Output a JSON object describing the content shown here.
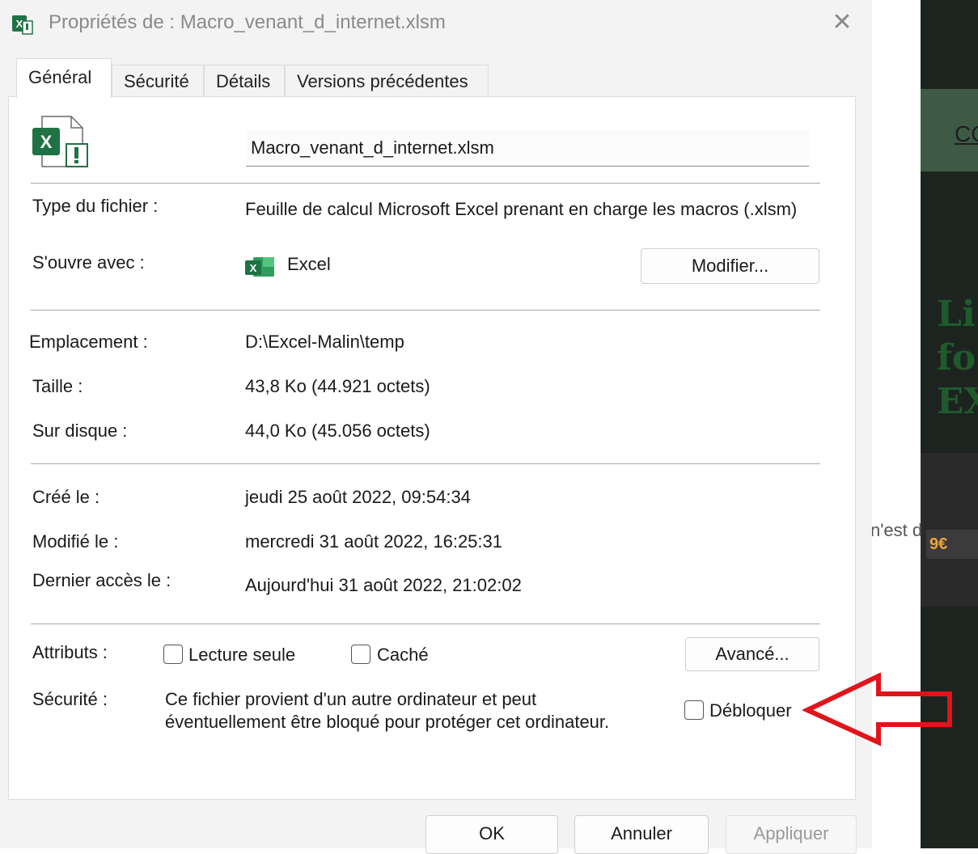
{
  "window": {
    "title": "Propriétés de : Macro_venant_d_internet.xlsm",
    "close_glyph": "✕"
  },
  "tabs": [
    {
      "label": "Général",
      "active": true
    },
    {
      "label": "Sécurité",
      "active": false
    },
    {
      "label": "Détails",
      "active": false
    },
    {
      "label": "Versions précédentes",
      "active": false
    }
  ],
  "file": {
    "name": "Macro_venant_d_internet.xlsm",
    "type_label": "Type du fichier :",
    "type_value": "Feuille de calcul Microsoft Excel prenant en charge les macros (.xlsm)",
    "opens_with_label": "S'ouvre avec :",
    "opens_with_value": "Excel",
    "change_button": "Modifier...",
    "location_label": "Emplacement :",
    "location_value": "D:\\Excel-Malin\\temp",
    "size_label": "Taille :",
    "size_value": "43,8 Ko (44.921 octets)",
    "disk_label": "Sur disque :",
    "disk_value": "44,0 Ko (45.056 octets)",
    "created_label": "Créé le :",
    "created_value": "jeudi 25 août 2022, 09:54:34",
    "modified_label": "Modifié le :",
    "modified_value": "mercredi 31 août 2022, 16:25:31",
    "accessed_label": "Dernier accès le :",
    "accessed_value": "Aujourd'hui 31 août 2022, 21:02:02"
  },
  "attributes": {
    "label": "Attributs :",
    "readonly_label": "Lecture seule",
    "readonly_checked": false,
    "hidden_label": "Caché",
    "hidden_checked": false,
    "advanced_button": "Avancé..."
  },
  "security": {
    "label": "Sécurité :",
    "text_line1": "Ce fichier provient d'un autre ordinateur et peut",
    "text_line2": "éventuellement être bloqué pour protéger cet ordinateur.",
    "unblock_label": "Débloquer",
    "unblock_checked": false
  },
  "footer": {
    "ok": "OK",
    "cancel": "Annuler",
    "apply": "Appliquer"
  },
  "background": {
    "link_text": "CO",
    "big_text": [
      "Li",
      "fo",
      "EX"
    ],
    "partial_text": "n'est d",
    "price_text": "9€"
  },
  "colors": {
    "excel_green": "#1f7244",
    "annotation_arrow": "#e0141b",
    "disabled_text": "#9a9a9a"
  }
}
